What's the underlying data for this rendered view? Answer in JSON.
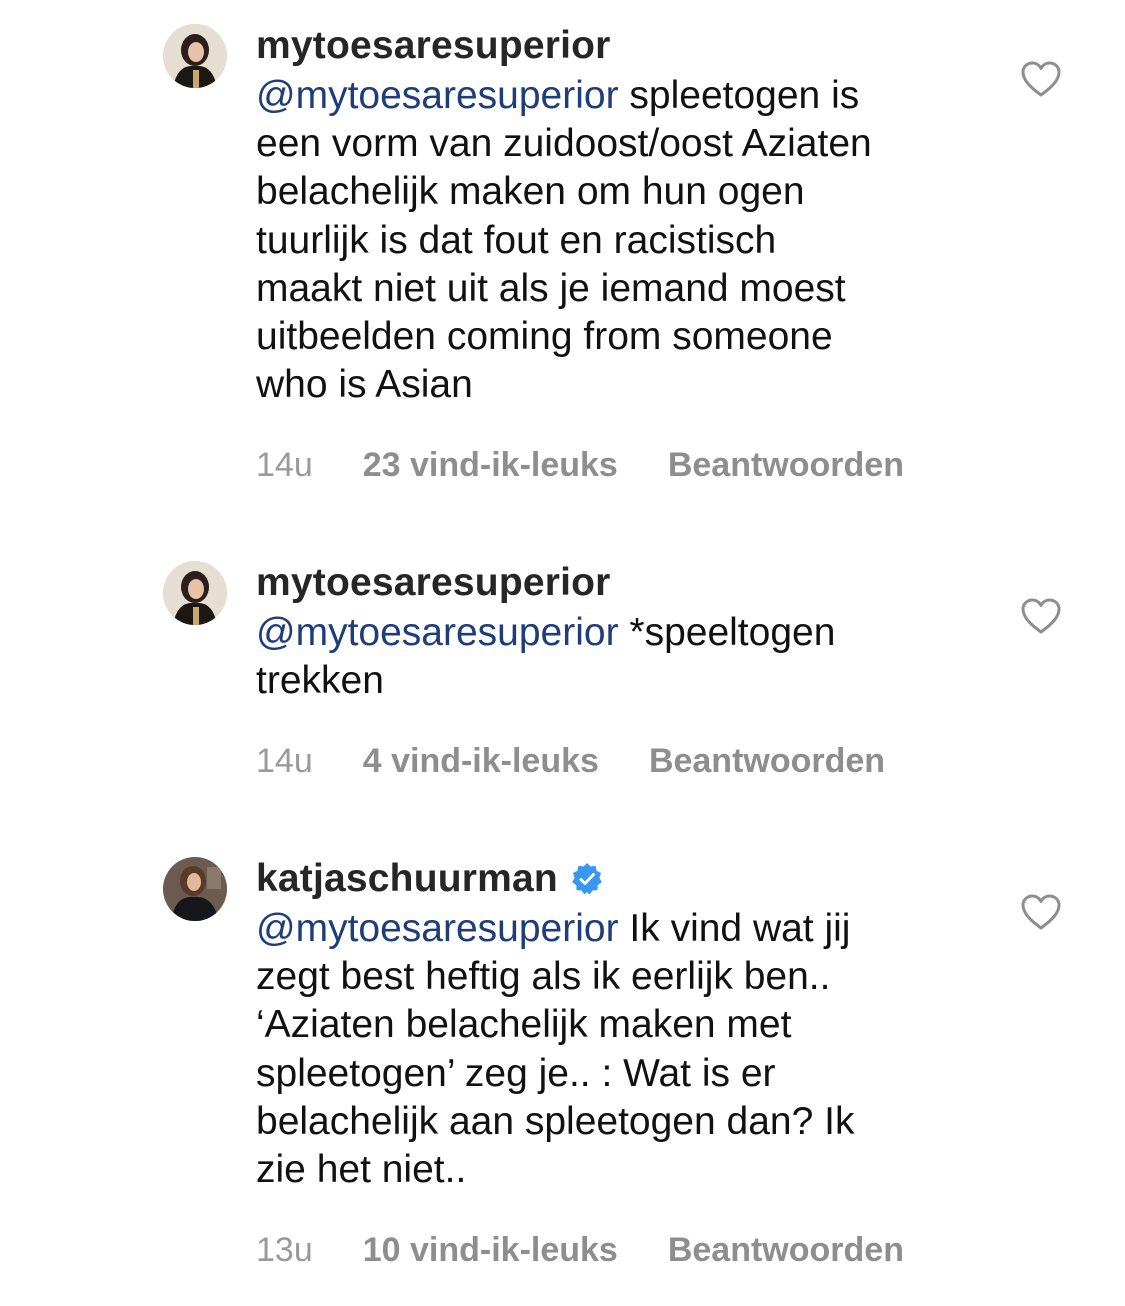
{
  "comments": [
    {
      "username": "mytoesaresuperior",
      "verified": false,
      "lines": [
        {
          "mention": "@mytoesaresuperior",
          "text": " spleetogen is"
        },
        {
          "mention": "",
          "text": "een vorm van zuidoost/oost Aziaten"
        },
        {
          "mention": "",
          "text": "belachelijk maken om hun ogen"
        },
        {
          "mention": "",
          "text": "tuurlijk is dat fout en racistisch"
        },
        {
          "mention": "",
          "text": "maakt niet uit als je iemand moest"
        },
        {
          "mention": "",
          "text": "uitbeelden coming from someone"
        },
        {
          "mention": "",
          "text": "who is Asian"
        }
      ],
      "time": "14u",
      "likes": "23 vind-ik-leuks",
      "reply": "Beantwoorden"
    },
    {
      "username": "mytoesaresuperior",
      "verified": false,
      "lines": [
        {
          "mention": "@mytoesaresuperior",
          "text": " *speeltogen"
        },
        {
          "mention": "",
          "text": "trekken"
        }
      ],
      "time": "14u",
      "likes": "4 vind-ik-leuks",
      "reply": "Beantwoorden"
    },
    {
      "username": "katjaschuurman",
      "verified": true,
      "lines": [
        {
          "mention": "@mytoesaresuperior",
          "text": " Ik vind wat jij"
        },
        {
          "mention": "",
          "text": "zegt best heftig als ik eerlijk ben.."
        },
        {
          "mention": "",
          "text": "‘Aziaten belachelijk maken met"
        },
        {
          "mention": "",
          "text": "spleetogen’ zeg je.. : Wat is er"
        },
        {
          "mention": "",
          "text": "belachelijk aan spleetogen dan? Ik"
        },
        {
          "mention": "",
          "text": "zie het niet.."
        }
      ],
      "time": "13u",
      "likes": "10 vind-ik-leuks",
      "reply": "Beantwoorden"
    }
  ],
  "colors": {
    "mention": "#1f3d7a",
    "meta": "#8e8e8e",
    "verified": "#3897f0"
  },
  "icons": {
    "like": "heart-outline-icon",
    "verified": "verified-badge-icon"
  }
}
